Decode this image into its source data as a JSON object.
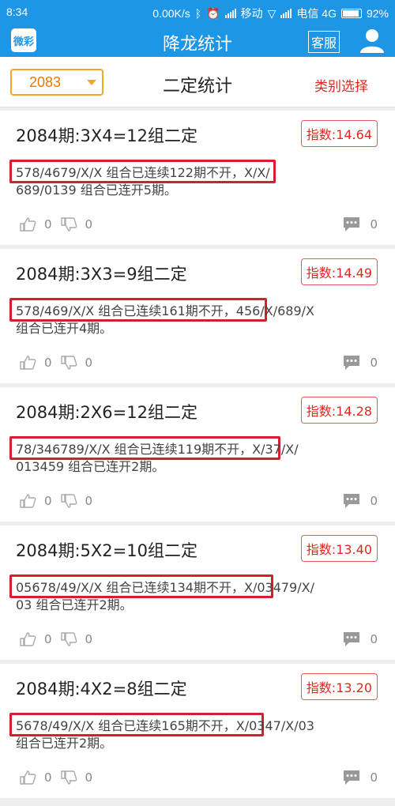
{
  "status": {
    "time": "8:34",
    "speed": "0.00K/s",
    "carrier1": "移动",
    "carrier2": "电信 4G",
    "battery": "92%"
  },
  "header": {
    "logo_text": "微彩",
    "title": "降龙统计",
    "service_label": "客服",
    "user_icon": "user-icon"
  },
  "subheader": {
    "period": "2083",
    "title": "二定统计",
    "category_label": "类别选择"
  },
  "cards": [
    {
      "title": "2084期:3X4=12组二定",
      "index": "指数:14.64",
      "line1": "578/4679/X/X 组合已连续122期不开，X/X/",
      "line2": "689/0139 组合已连开5期。",
      "likes": "0",
      "dislikes": "0",
      "comments": "0"
    },
    {
      "title": "2084期:3X3=9组二定",
      "index": "指数:14.49",
      "line1": "578/469/X/X 组合已连续161期不开，456/X/689/X",
      "line2": "组合已连开4期。",
      "likes": "0",
      "dislikes": "0",
      "comments": "0"
    },
    {
      "title": "2084期:2X6=12组二定",
      "index": "指数:14.28",
      "line1": "78/346789/X/X 组合已连续119期不开，X/37/X/",
      "line2": "013459 组合已连开2期。",
      "likes": "0",
      "dislikes": "0",
      "comments": "0"
    },
    {
      "title": "2084期:5X2=10组二定",
      "index": "指数:13.40",
      "line1": "05678/49/X/X 组合已连续134期不开，X/03479/X/",
      "line2": "03 组合已连开2期。",
      "likes": "0",
      "dislikes": "0",
      "comments": "0"
    },
    {
      "title": "2084期:4X2=8组二定",
      "index": "指数:13.20",
      "line1": "5678/49/X/X 组合已连续165期不开，X/0347/X/03",
      "line2": "组合已连开2期。",
      "likes": "0",
      "dislikes": "0",
      "comments": "0"
    }
  ],
  "colors": {
    "brand": "#1e96e6",
    "accent": "#e0281e",
    "highlight_box": "#d4202e",
    "select_border": "#f5a623"
  }
}
